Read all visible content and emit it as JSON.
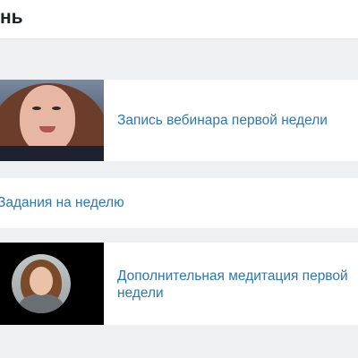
{
  "header": {
    "title": "нь"
  },
  "lessons": [
    {
      "title": "Запись вебинара первой недели",
      "thumbnail": "video-thumbnail"
    },
    {
      "title": "Задания на неделю"
    },
    {
      "title": "Дополнительная медитация первой недели",
      "thumbnail": "meditation-thumbnail"
    }
  ],
  "colors": {
    "link": "#2f76ad",
    "background": "#eef0f2",
    "card": "#ffffff",
    "title": "#1f2328"
  }
}
